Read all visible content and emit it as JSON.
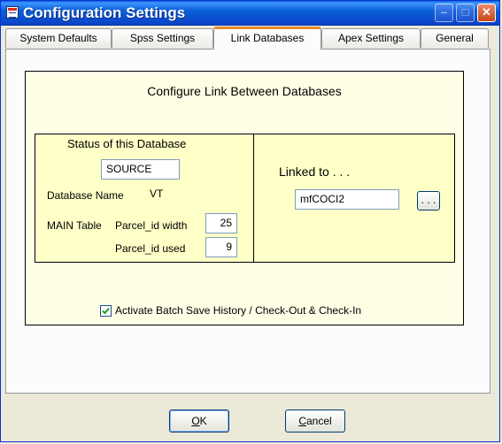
{
  "window": {
    "title": "Configuration Settings"
  },
  "titlebar_buttons": {
    "minimize": "–",
    "maximize": "□",
    "close": "✕"
  },
  "tabs": [
    {
      "label": "System Defaults"
    },
    {
      "label": "Spss Settings"
    },
    {
      "label": "Link Databases"
    },
    {
      "label": "Apex Settings"
    },
    {
      "label": "General"
    }
  ],
  "active_tab": "Link Databases",
  "panel": {
    "title": "Configure Link Between Databases",
    "status": {
      "heading": "Status of this Database",
      "source_value": "SOURCE",
      "database_name_label": "Database Name",
      "database_name_value": "VT",
      "main_table_label": "MAIN Table",
      "parcel_width_label": "Parcel_id width",
      "parcel_width_value": "25",
      "parcel_used_label": "Parcel_id used",
      "parcel_used_value": "9"
    },
    "linked": {
      "heading": "Linked to . . .",
      "value": "mfCOCI2",
      "browse_label": ". . ."
    },
    "checkbox": {
      "label": "Activate Batch Save History / Check-Out & Check-In",
      "checked": true
    }
  },
  "buttons": {
    "ok_label": "OK",
    "ok_rest": "K",
    "ok_mnemonic": "O",
    "cancel_mnemonic": "C",
    "cancel_rest": "ancel"
  }
}
